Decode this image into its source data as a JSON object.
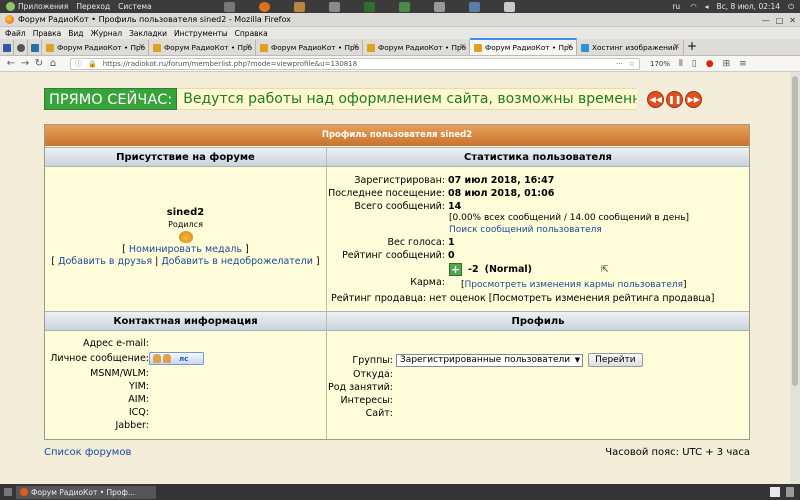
{
  "system_panel": {
    "menus": [
      "Приложения",
      "Переход",
      "Система"
    ],
    "clock": "Вс, 8 июл, 02:14",
    "keyboard_layout": "ru"
  },
  "window": {
    "title": "Форум РадиоКот • Профиль пользователя sined2 - Mozilla Firefox"
  },
  "menubar": [
    "Файл",
    "Правка",
    "Вид",
    "Журнал",
    "Закладки",
    "Инструменты",
    "Справка"
  ],
  "tabs": [
    {
      "label": "Форум РадиоКот • Про",
      "active": false
    },
    {
      "label": "Форум РадиоКот • Про",
      "active": false
    },
    {
      "label": "Форум РадиоКот • Про",
      "active": false
    },
    {
      "label": "Форум РадиоКот • Про",
      "active": false
    },
    {
      "label": "Форум РадиоКот • Про",
      "active": true
    },
    {
      "label": "Хостинг изображений",
      "active": false
    }
  ],
  "navbar": {
    "url": "https://radiokot.ru/forum/memberlist.php?mode=viewprofile&u=130818",
    "zoom": "170%"
  },
  "ticker": {
    "label": "ПРЯМО СЕЙЧАС:",
    "message": "Ведутся работы над оформлением сайта, возможны временные глюки и"
  },
  "profile": {
    "title": "Профиль пользователя sined2",
    "presence": {
      "header": "Присутствие на форуме",
      "username": "sined2",
      "born": "Родился",
      "medal_link": "Номинировать медаль",
      "friends_link": "Добавить в друзья",
      "foes_link": "Добавить в недоброжелатели"
    },
    "stats": {
      "header": "Статистика пользователя",
      "registered_label": "Зарегистрирован:",
      "registered_value": "07 июл 2018, 16:47",
      "last_visit_label": "Последнее посещение:",
      "last_visit_value": "08 июл 2018, 01:06",
      "posts_label": "Всего сообщений:",
      "posts_value": "14",
      "posts_detail": "[0.00% всех сообщений / 14.00 сообщений в день]",
      "search_posts_link": "Поиск сообщений пользователя",
      "vote_weight_label": "Вес голоса:",
      "vote_weight_value": "1",
      "rating_label": "Рейтинг сообщений:",
      "rating_value": "0",
      "karma_label": "Карма:",
      "karma_plus": "+",
      "karma_value": "-2",
      "karma_status": "(Normal)",
      "karma_history_link": "Просмотреть изменения кармы пользователя",
      "seller_rating": "Рейтинг продавца: нет оценок [Посмотреть изменения рейтинга продавца]"
    },
    "contacts": {
      "header": "Контактная информация",
      "email_label": "Адрес e-mail:",
      "pm_label": "Личное сообщение:",
      "pm_button": "лс",
      "msnm_label": "MSNM/WLM:",
      "yim_label": "YIM:",
      "aim_label": "AIM:",
      "icq_label": "ICQ:",
      "jabber_label": "Jabber:"
    },
    "profile_section": {
      "header": "Профиль",
      "groups_label": "Группы:",
      "groups_selected": "Зарегистрированные пользователи",
      "go_button": "Перейти",
      "from_label": "Откуда:",
      "occupation_label": "Род занятий:",
      "interests_label": "Интересы:",
      "site_label": "Сайт:"
    }
  },
  "footer": {
    "forum_list_link": "Список форумов",
    "timezone": "Часовой пояс: UTC + 3 часа"
  },
  "taskbar": {
    "task": "Форум РадиоКот • Проф..."
  }
}
